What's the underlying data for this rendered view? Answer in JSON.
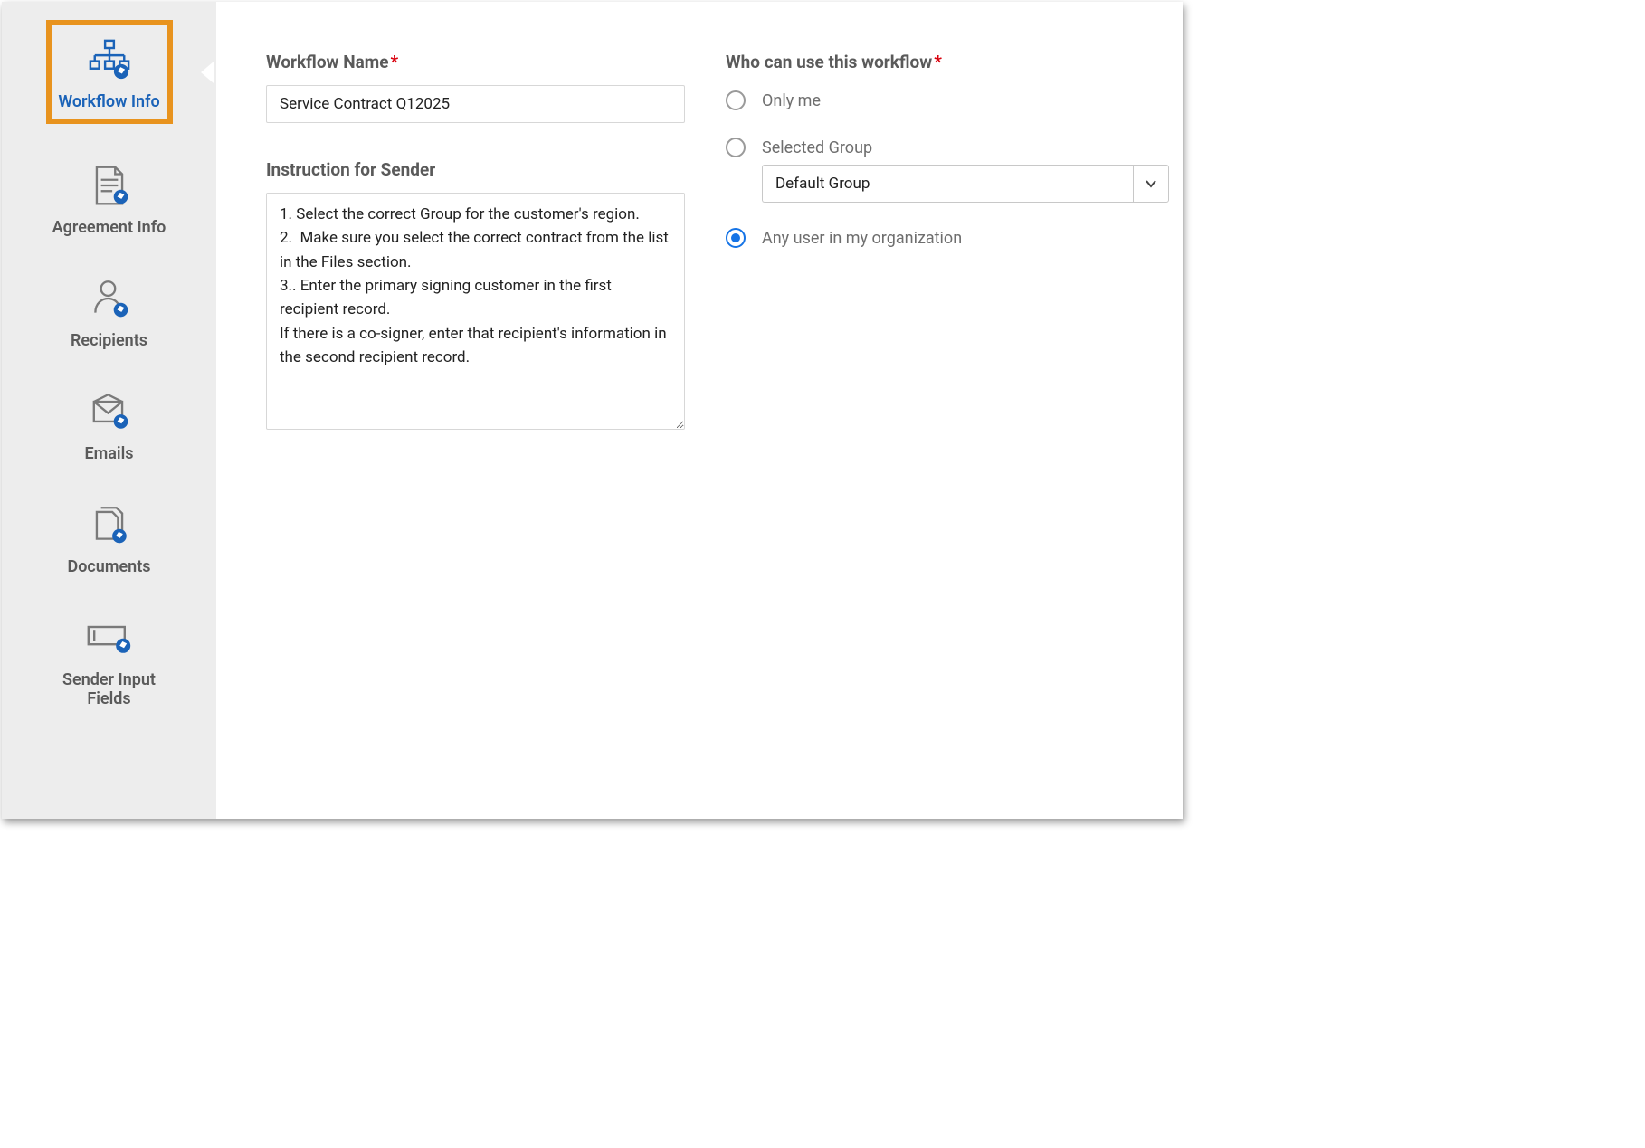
{
  "sidebar": {
    "items": [
      {
        "label": "Workflow Info",
        "active": true
      },
      {
        "label": "Agreement Info"
      },
      {
        "label": "Recipients"
      },
      {
        "label": "Emails"
      },
      {
        "label": "Documents"
      },
      {
        "label": "Sender Input Fields"
      }
    ]
  },
  "form": {
    "workflow_name_label": "Workflow Name",
    "workflow_name_value": "Service Contract Q12025",
    "instruction_label": "Instruction for Sender",
    "instruction_value": "1. Select the correct Group for the customer's region.\n2.  Make sure you select the correct contract from the list in the Files section.\n3.. Enter the primary signing customer in the first recipient record.\nIf there is a co-signer, enter that recipient's information in the second recipient record.",
    "who_label": "Who can use this workflow",
    "radios": {
      "only_me": "Only me",
      "selected_group": "Selected Group",
      "any_user": "Any user in my organization",
      "selected": "any_user"
    },
    "group_select_value": "Default Group"
  },
  "colors": {
    "accent_blue": "#1b63b8",
    "radio_blue": "#1473e6",
    "highlight_orange": "#e8931e",
    "required_red": "#d9000d"
  }
}
